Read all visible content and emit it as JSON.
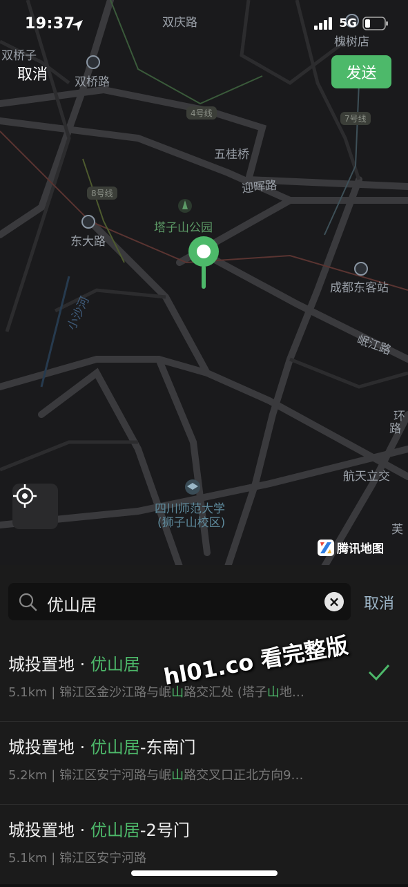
{
  "status": {
    "time": "19:37",
    "network": "5G"
  },
  "header": {
    "cancel_label": "取消",
    "send_label": "发送"
  },
  "map": {
    "labels": {
      "shuangqing_road": "双庆路",
      "shuangqiao": "双桥子",
      "shuangqiao_road": "双桥路",
      "huaishudian": "槐树店",
      "wuguiqiao": "五桂桥",
      "yinghui_road": "迎晖路",
      "tazishan_park": "塔子山公园",
      "dongda_road": "东大路",
      "chengdu_east": "成都东客站",
      "xiaoshahe": "小沙河",
      "minjiang_road": "岷江路",
      "huan": "环",
      "lu": "路",
      "hangtianlijiao": "航天立交",
      "sichuan_normal": "四川师范大学",
      "shizishan_campus": "(狮子山校区)",
      "fu": "芙"
    },
    "metro_lines": {
      "line4": "4号线",
      "line7": "7号线",
      "line8": "8号线"
    },
    "brand": "腾讯地图"
  },
  "search": {
    "query": "优山居",
    "cancel_label": "取消"
  },
  "results": [
    {
      "prefix": "城投置地 · ",
      "highlight": "优山居",
      "suffix": "",
      "sub_a": "5.1km | 锦江区金沙江路与岷",
      "sub_hl1": "山",
      "sub_b": "路交汇处 (塔子",
      "sub_hl2": "山",
      "sub_c": "地…"
    },
    {
      "prefix": "城投置地 · ",
      "highlight": "优山居",
      "suffix": "-东南门",
      "sub_a": "5.2km | 锦江区安宁河路与岷",
      "sub_hl1": "山",
      "sub_b": "路交叉口正北方向9…",
      "sub_hl2": "",
      "sub_c": ""
    },
    {
      "prefix": "城投置地 · ",
      "highlight": "优山居",
      "suffix": "-2号门",
      "sub_a": "5.1km | 锦江区安宁河路",
      "sub_hl1": "",
      "sub_b": "",
      "sub_hl2": "",
      "sub_c": ""
    }
  ],
  "watermark": "hl01.co 看完整版",
  "colors": {
    "accent": "#4db96a",
    "map_bg": "#1a1a1c",
    "panel_bg": "#1b1b1b"
  }
}
